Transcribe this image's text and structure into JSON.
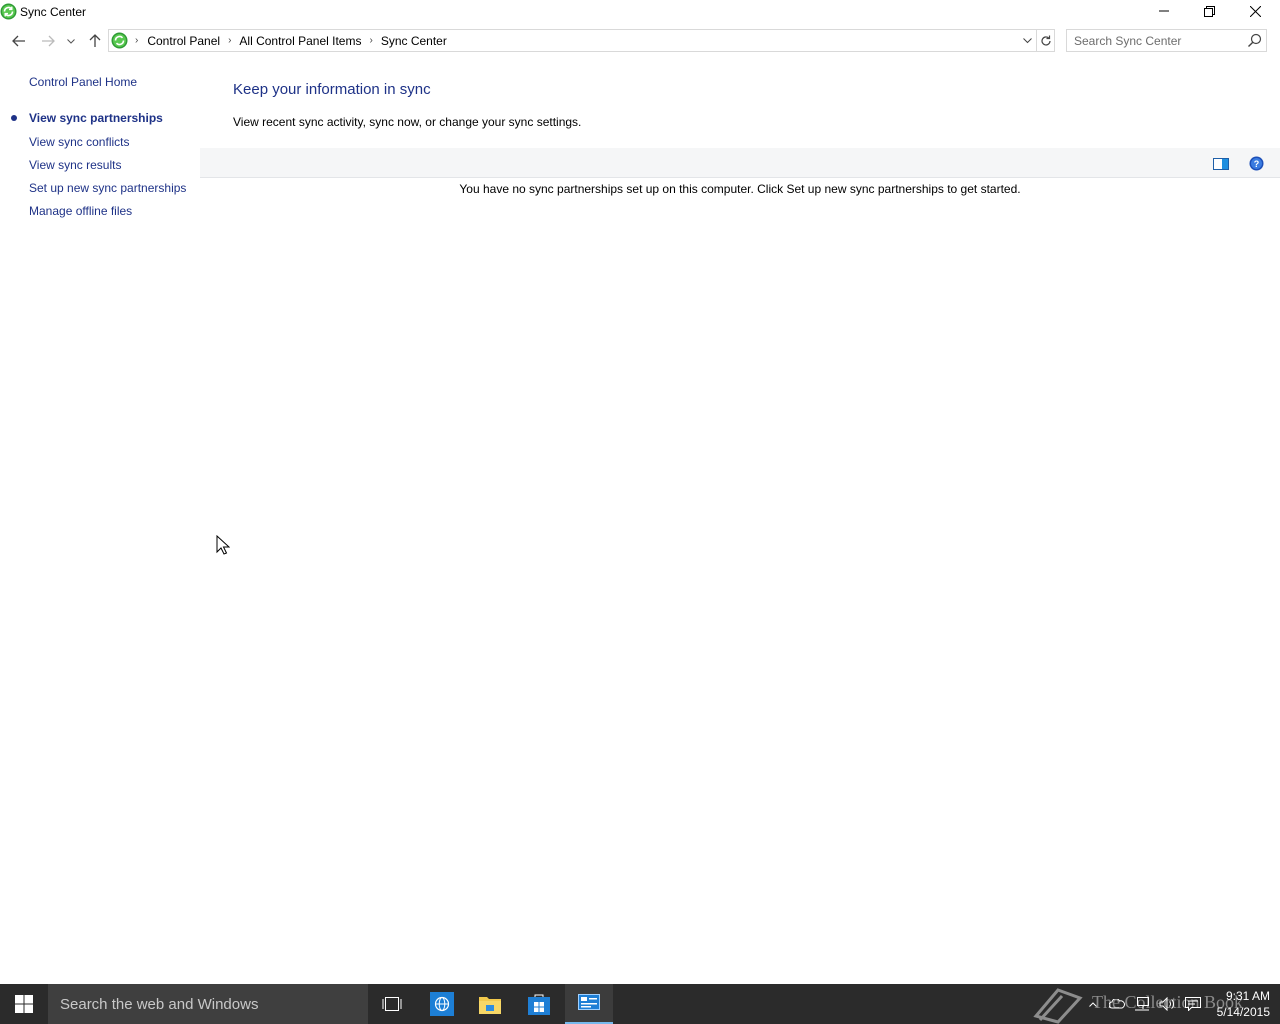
{
  "window": {
    "title": "Sync Center"
  },
  "address_bar": {
    "breadcrumbs": [
      "Control Panel",
      "All Control Panel Items",
      "Sync Center"
    ]
  },
  "search": {
    "placeholder": "Search Sync Center"
  },
  "sidebar": {
    "home": "Control Panel Home",
    "items": [
      {
        "label": "View sync partnerships",
        "active": true
      },
      {
        "label": "View sync conflicts",
        "active": false
      },
      {
        "label": "View sync results",
        "active": false
      },
      {
        "label": "Set up new sync partnerships",
        "active": false
      },
      {
        "label": "Manage offline files",
        "active": false
      }
    ]
  },
  "main": {
    "title": "Keep your information in sync",
    "subtitle": "View recent sync activity, sync now, or change your sync settings.",
    "empty_message": "You have no sync partnerships set up on this computer. Click Set up new sync partnerships to get started."
  },
  "taskbar": {
    "search_placeholder": "Search the web and Windows",
    "time": "9:31 AM",
    "date": "5/14/2015",
    "watermark": "The Collection Book"
  },
  "colors": {
    "link": "#1e3287",
    "taskbar": "#2b2b2b",
    "sync_green": "#3aa83a"
  },
  "icons": {
    "app": "sync-center-icon",
    "back": "back-arrow-icon",
    "forward": "forward-arrow-icon",
    "up": "up-arrow-icon",
    "refresh": "refresh-icon",
    "search": "search-icon",
    "help": "help-icon",
    "preview": "preview-pane-icon"
  }
}
